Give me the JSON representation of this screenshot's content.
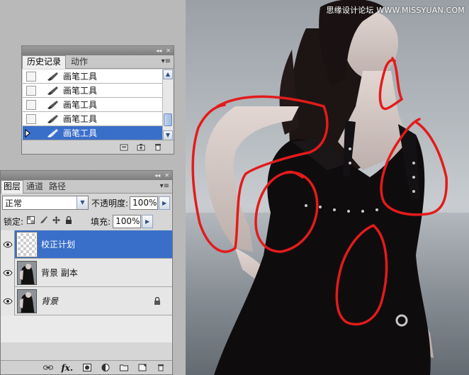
{
  "watermark": "思缘设计论坛 WWW.MISSYUAN.COM",
  "history_panel": {
    "tabs": [
      {
        "label": "历史记录",
        "active": true
      },
      {
        "label": "动作",
        "active": false
      }
    ],
    "items": [
      {
        "label": "画笔工具",
        "selected": false
      },
      {
        "label": "画笔工具",
        "selected": false
      },
      {
        "label": "画笔工具",
        "selected": false
      },
      {
        "label": "画笔工具",
        "selected": false
      },
      {
        "label": "画笔工具",
        "selected": true
      }
    ],
    "bottom_icons": [
      "new-document-from-state-icon",
      "camera-snapshot-icon",
      "trash-icon"
    ]
  },
  "layers_panel": {
    "tabs": [
      {
        "label": "图层",
        "active": true
      },
      {
        "label": "通道",
        "active": false
      },
      {
        "label": "路径",
        "active": false
      }
    ],
    "blend_mode": "正常",
    "opacity_label": "不透明度:",
    "opacity_value": "100%",
    "lock_label": "锁定:",
    "fill_label": "填充:",
    "fill_value": "100%",
    "layers": [
      {
        "name": "校正计划",
        "selected": true,
        "thumb": "transparent",
        "italic": false,
        "locked": false
      },
      {
        "name": "背景 副本",
        "selected": false,
        "thumb": "photo",
        "italic": false,
        "locked": false
      },
      {
        "name": "背景",
        "selected": false,
        "thumb": "photo",
        "italic": true,
        "locked": true
      }
    ],
    "bottom_icons": [
      "link-layers-icon",
      "layer-style-fx-icon",
      "add-mask-icon",
      "adjustment-layer-icon",
      "new-group-icon",
      "new-layer-icon",
      "delete-layer-icon"
    ],
    "fx_label": "fx."
  },
  "colors": {
    "selection": "#3a6fc9",
    "markup_red": "#e31b1b"
  }
}
